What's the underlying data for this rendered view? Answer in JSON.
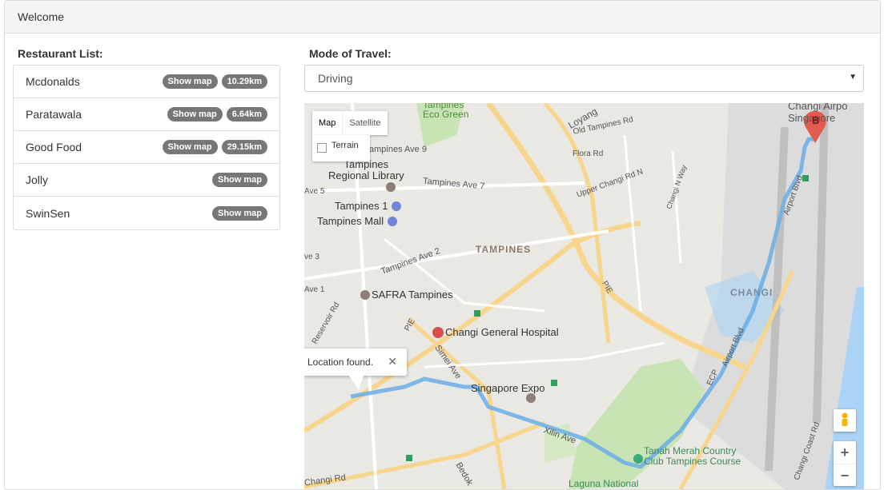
{
  "header": {
    "title": "Welcome"
  },
  "restaurants": {
    "label": "Restaurant List:",
    "items": [
      {
        "name": "Mcdonalds",
        "button": "Show map",
        "distance": "10.29km"
      },
      {
        "name": "Paratawala",
        "button": "Show map",
        "distance": "6.64km"
      },
      {
        "name": "Good Food",
        "button": "Show map",
        "distance": "29.15km"
      },
      {
        "name": "Jolly",
        "button": "Show map",
        "distance": ""
      },
      {
        "name": "SwinSen",
        "button": "Show map",
        "distance": ""
      }
    ]
  },
  "travel": {
    "label": "Mode of Travel:",
    "selected": "Driving"
  },
  "map": {
    "type_map": "Map",
    "type_satellite": "Satellite",
    "terrain": "Terrain",
    "popup": "Location found.",
    "marker": "B",
    "zoom_in": "+",
    "zoom_out": "−",
    "labels": {
      "tampines_eco": "Tampines\nEco Green",
      "changi_airport": "Changi Airpo\nSingapore",
      "loyang": "Loyang",
      "old_tampines": "Old Tampines Rd",
      "flora": "Flora Rd",
      "tampines_ave9": "ampines Ave 9",
      "tampines_library": "Tampines\nRegional Library",
      "tampines_ave7": "Tampines Ave 7",
      "ave5": "Ave 5",
      "tampines1": "Tampines 1",
      "tampines_mall": "Tampines Mall",
      "upper_changi": "Upper Changi Rd N",
      "changi_n_way": "Changi N Way",
      "airport_blvd": "Airport Blvd",
      "ave3": "ve 3",
      "tampines_ave2": "Tampines Ave 2",
      "tampines": "TAMPINES",
      "pie1": "PIE",
      "changi": "CHANGI",
      "ave1": "Ave 1",
      "safra": "SAFRA Tampines",
      "reservoir": "Reservoir Rd",
      "pie2": "PIE",
      "changi_hospital": "Changi General Hospital",
      "airport_blvd2": "Airport Blvd",
      "simei": "Simei Ave",
      "singapore_expo": "Singapore Expo",
      "ecp": "ECP",
      "xilin": "Xilin Ave",
      "tanah_merah": "Tanah Merah Country\nClub Tampines Course",
      "changi_rd": "Changi Rd",
      "bedok": "Bedok",
      "laguna": "Laguna National",
      "changi_coast": "Changi Coast Rd"
    }
  }
}
